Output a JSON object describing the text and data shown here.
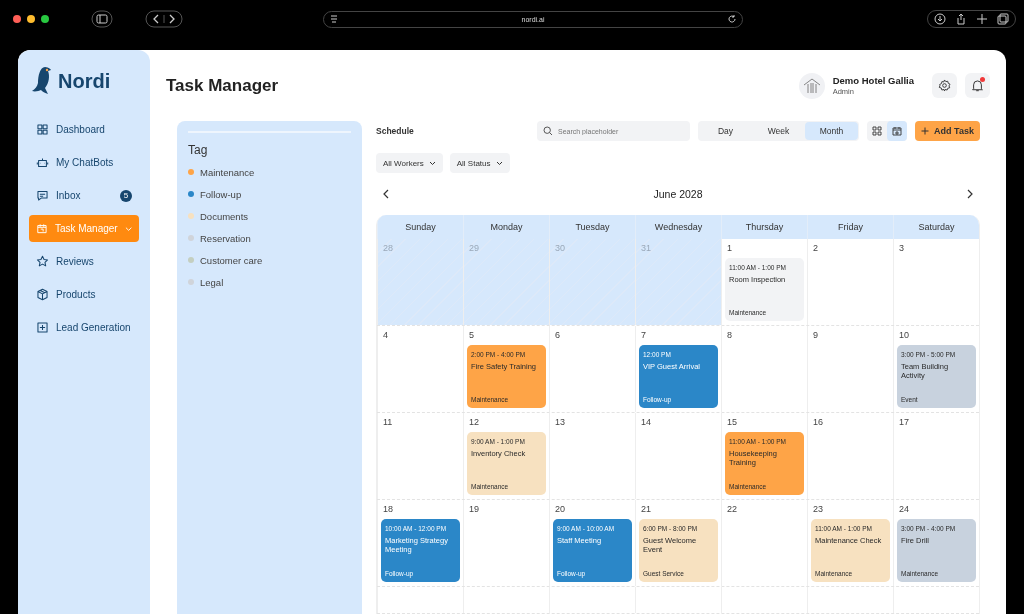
{
  "browser": {
    "url": "nordi.ai"
  },
  "sidebar": {
    "logo": "Nordi",
    "items": [
      {
        "label": "Dashboard",
        "selected": false,
        "expandable": false
      },
      {
        "label": "My ChatBots",
        "selected": false,
        "expandable": false
      },
      {
        "label": "Inbox",
        "selected": false,
        "expandable": false,
        "badge": "5"
      },
      {
        "label": "Task Manager",
        "selected": true,
        "expandable": true
      },
      {
        "label": "Reviews",
        "selected": false,
        "expandable": false
      },
      {
        "label": "Products",
        "selected": false,
        "expandable": false
      },
      {
        "label": "Lead Generation",
        "selected": false,
        "expandable": false
      }
    ]
  },
  "header": {
    "title": "Task Manager",
    "user": {
      "name": "Demo Hotel Gallia",
      "role": "Admin"
    },
    "notification_dot": true
  },
  "tags": {
    "title": "Tag",
    "items": [
      {
        "label": "Maintenance",
        "color": "#fea447"
      },
      {
        "label": "Follow-up",
        "color": "#2b87c8"
      },
      {
        "label": "Documents",
        "color": "#f7e1c0"
      },
      {
        "label": "Reservation",
        "color": "#d0d4da"
      },
      {
        "label": "Customer care",
        "color": "#c4cfc0"
      },
      {
        "label": "Legal",
        "color": "#d0d4da"
      }
    ]
  },
  "schedule": {
    "title": "Schedule",
    "search": {
      "placeholder": "Search placeholder"
    },
    "views": [
      {
        "label": "Day",
        "selected": false
      },
      {
        "label": "Week",
        "selected": false
      },
      {
        "label": "Month",
        "selected": true
      }
    ],
    "layouts": [
      {
        "kind": "grid",
        "selected": false
      },
      {
        "kind": "calendar",
        "selected": true
      }
    ],
    "add_button": "Add Task",
    "filters": [
      "All Workers",
      "All Status"
    ],
    "month": "June 2028",
    "weekdays": [
      "Sunday",
      "Monday",
      "Tuesday",
      "Wednesday",
      "Thursday",
      "Friday",
      "Saturday"
    ],
    "weeks": [
      [
        {
          "day": "28",
          "outside": true
        },
        {
          "day": "29",
          "outside": true
        },
        {
          "day": "30",
          "outside": true
        },
        {
          "day": "31",
          "outside": true
        },
        {
          "day": "1",
          "outside": false,
          "events": [
            {
              "time": "11:00 AM - 1:00 PM",
              "title": "Room Inspection",
              "tag": "Maintenance",
              "color": "#f2f3f5"
            }
          ]
        },
        {
          "day": "2",
          "outside": false
        },
        {
          "day": "3",
          "outside": false
        }
      ],
      [
        {
          "day": "4",
          "outside": false
        },
        {
          "day": "5",
          "outside": false,
          "events": [
            {
              "time": "2:00 PM - 4:00 PM",
              "title": "Fire Safety Training",
              "tag": "Maintenance",
              "color": "#fea447"
            }
          ]
        },
        {
          "day": "6",
          "outside": false
        },
        {
          "day": "7",
          "outside": false,
          "events": [
            {
              "time": "12:00 PM",
              "title": "VIP Guest Arrival",
              "tag": "Follow-up",
              "color": "#2b87c8"
            }
          ]
        },
        {
          "day": "8",
          "outside": false
        },
        {
          "day": "9",
          "outside": false
        },
        {
          "day": "10",
          "outside": false,
          "events": [
            {
              "time": "3:00 PM - 5:00 PM",
              "title": "Team Building Activity",
              "tag": "Event",
              "color": "#c8d2de"
            }
          ]
        }
      ],
      [
        {
          "day": "11",
          "outside": false
        },
        {
          "day": "12",
          "outside": false,
          "events": [
            {
              "time": "9:00 AM - 1:00 PM",
              "title": "Inventory Check",
              "tag": "Maintenance",
              "color": "#f7e1c0"
            }
          ]
        },
        {
          "day": "13",
          "outside": false
        },
        {
          "day": "14",
          "outside": false
        },
        {
          "day": "15",
          "outside": false,
          "events": [
            {
              "time": "11:00 AM - 1:00 PM",
              "title": "Housekeeping Training",
              "tag": "Maintenance",
              "color": "#fea447"
            }
          ]
        },
        {
          "day": "16",
          "outside": false
        },
        {
          "day": "17",
          "outside": false
        }
      ],
      [
        {
          "day": "18",
          "outside": false,
          "events": [
            {
              "time": "10:00 AM - 12:00 PM",
              "title": "Marketing Strategy Meeting",
              "tag": "Follow-up",
              "color": "#2b87c8"
            }
          ]
        },
        {
          "day": "19",
          "outside": false
        },
        {
          "day": "20",
          "outside": false,
          "events": [
            {
              "time": "9:00 AM - 10:00 AM",
              "title": "Staff Meeting",
              "tag": "Follow-up",
              "color": "#2b87c8"
            }
          ]
        },
        {
          "day": "21",
          "outside": false,
          "events": [
            {
              "time": "6:00 PM - 8:00 PM",
              "title": "Guest Welcome Event",
              "tag": "Guest Service",
              "color": "#f7e1c0"
            }
          ]
        },
        {
          "day": "22",
          "outside": false
        },
        {
          "day": "23",
          "outside": false,
          "events": [
            {
              "time": "11:00 AM - 1:00 PM",
              "title": "Maintenance Check",
              "tag": "Maintenance",
              "color": "#f7e1c0"
            }
          ]
        },
        {
          "day": "24",
          "outside": false,
          "events": [
            {
              "time": "3:00 PM - 4:00 PM",
              "title": "Fire Drill",
              "tag": "Maintenance",
              "color": "#c8d2de"
            }
          ]
        }
      ]
    ]
  }
}
